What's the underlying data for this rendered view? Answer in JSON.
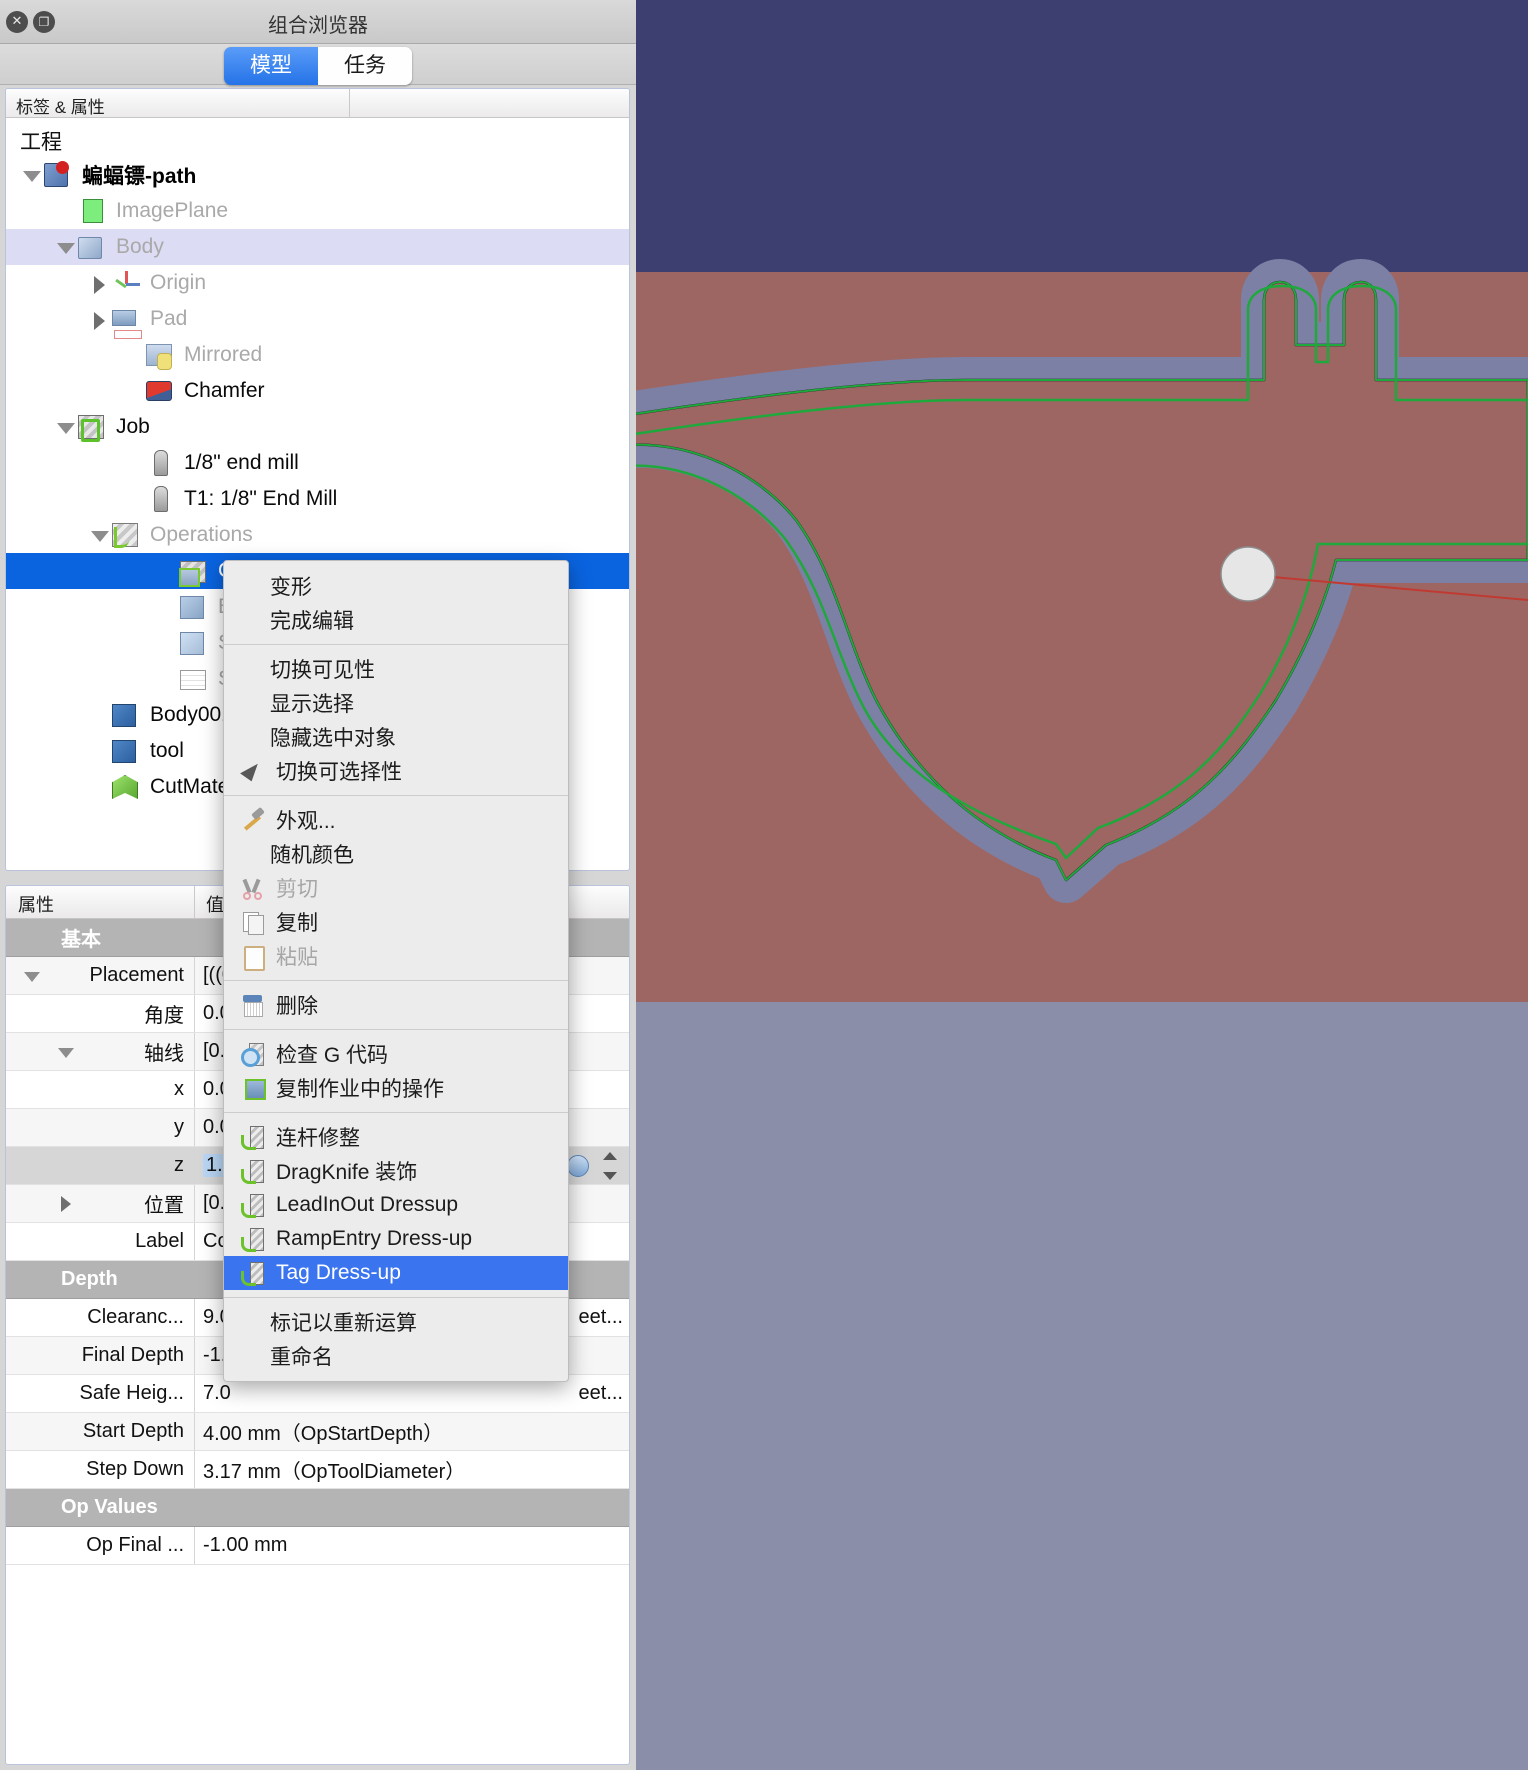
{
  "window": {
    "title": "组合浏览器",
    "close_label": "✕",
    "float_label": "❐"
  },
  "tabs": [
    {
      "label": "模型",
      "active": true
    },
    {
      "label": "任务",
      "active": false
    }
  ],
  "tree": {
    "header_col1": "标签 & 属性",
    "header_col2": "",
    "root_label": "工程",
    "items": [
      {
        "label": "蝙蝠镖-path",
        "indent": 0,
        "arrow": "down",
        "icon": "document-icon",
        "style": "bold"
      },
      {
        "label": "ImagePlane",
        "indent": 1,
        "arrow": "none",
        "icon": "image-plane-icon",
        "style": "muted"
      },
      {
        "label": "Body",
        "indent": 1,
        "arrow": "down",
        "icon": "body-icon",
        "style": "muted",
        "row": "lightsel"
      },
      {
        "label": "Origin",
        "indent": 2,
        "arrow": "right",
        "icon": "origin-icon",
        "style": "muted"
      },
      {
        "label": "Pad",
        "indent": 2,
        "arrow": "right",
        "icon": "pad-icon",
        "style": "muted"
      },
      {
        "label": "Mirrored",
        "indent": 3,
        "arrow": "none",
        "icon": "mirrored-icon",
        "style": "muted"
      },
      {
        "label": "Chamfer",
        "indent": 3,
        "arrow": "none",
        "icon": "chamfer-icon",
        "style": "dark"
      },
      {
        "label": "Job",
        "indent": 1,
        "arrow": "down",
        "icon": "job-icon",
        "style": "dark"
      },
      {
        "label": "1/8\" end mill",
        "indent": 3,
        "arrow": "none",
        "icon": "endmill-icon",
        "style": "dark"
      },
      {
        "label": "T1: 1/8\" End Mill",
        "indent": 3,
        "arrow": "none",
        "icon": "endmill-icon",
        "style": "dark"
      },
      {
        "label": "Operations",
        "indent": 2,
        "arrow": "down",
        "icon": "operations-icon",
        "style": "muted"
      },
      {
        "label": "Contour",
        "indent": 4,
        "arrow": "none",
        "icon": "contour-icon",
        "style": "selected",
        "row": "sel"
      },
      {
        "label": "Base-",
        "indent": 4,
        "arrow": "none",
        "icon": "cube-icon",
        "style": "muted"
      },
      {
        "label": "Stock",
        "indent": 4,
        "arrow": "none",
        "icon": "cube-pale-icon",
        "style": "muted"
      },
      {
        "label": "Setup",
        "indent": 4,
        "arrow": "none",
        "icon": "setup-icon",
        "style": "muted"
      },
      {
        "label": "Body001",
        "indent": 2,
        "arrow": "none",
        "icon": "cube-blue-icon",
        "style": "dark"
      },
      {
        "label": "tool",
        "indent": 2,
        "arrow": "none",
        "icon": "cube-blue-icon",
        "style": "dark"
      },
      {
        "label": "CutMaterial",
        "indent": 2,
        "arrow": "none",
        "icon": "cutmaterial-icon",
        "style": "dark"
      }
    ]
  },
  "context_menu": {
    "groups": [
      {
        "items": [
          {
            "label": "变形",
            "icon": "",
            "state": "normal"
          },
          {
            "label": "完成编辑",
            "icon": "",
            "state": "normal"
          }
        ]
      },
      {
        "items": [
          {
            "label": "切换可见性",
            "icon": "",
            "state": "normal"
          },
          {
            "label": "显示选择",
            "icon": "",
            "state": "normal"
          },
          {
            "label": "隐藏选中对象",
            "icon": "",
            "state": "normal"
          },
          {
            "label": "切换可选择性",
            "icon": "cursor-icon",
            "state": "normal"
          }
        ]
      },
      {
        "items": [
          {
            "label": "外观...",
            "icon": "hammer-icon",
            "state": "normal"
          },
          {
            "label": "随机颜色",
            "icon": "",
            "state": "normal"
          },
          {
            "label": "剪切",
            "icon": "scissors-icon",
            "state": "disabled"
          },
          {
            "label": "复制",
            "icon": "copy-icon",
            "state": "normal"
          },
          {
            "label": "粘贴",
            "icon": "paste-icon",
            "state": "disabled"
          }
        ]
      },
      {
        "items": [
          {
            "label": "删除",
            "icon": "trash-icon",
            "state": "normal"
          }
        ]
      },
      {
        "items": [
          {
            "label": "检查 G 代码",
            "icon": "gcode-icon",
            "state": "normal"
          },
          {
            "label": "复制作业中的操作",
            "icon": "duplicate-icon",
            "state": "normal"
          }
        ]
      },
      {
        "items": [
          {
            "label": "连杆修整",
            "icon": "dressup-icon",
            "state": "normal"
          },
          {
            "label": "DragKnife 装饰",
            "icon": "dressup-icon",
            "state": "normal"
          },
          {
            "label": "LeadInOut Dressup",
            "icon": "dressup-icon",
            "state": "normal"
          },
          {
            "label": "RampEntry Dress-up",
            "icon": "dressup-icon",
            "state": "normal"
          },
          {
            "label": "Tag Dress-up",
            "icon": "dressup-icon",
            "state": "highlighted"
          }
        ]
      },
      {
        "items": [
          {
            "label": "标记以重新运算",
            "icon": "",
            "state": "normal"
          },
          {
            "label": "重命名",
            "icon": "",
            "state": "normal"
          }
        ]
      }
    ]
  },
  "properties": {
    "header_name": "属性",
    "header_value": "值",
    "rows": [
      {
        "name": "基本",
        "value": "",
        "kind": "group"
      },
      {
        "name": "Placement",
        "value": "[((0",
        "kind": "alt",
        "twisty": "down",
        "indent": 0
      },
      {
        "name": "角度",
        "value": "0.0",
        "kind": "white",
        "twisty": "none",
        "indent": 1
      },
      {
        "name": "轴线",
        "value": "[0.",
        "kind": "alt",
        "twisty": "down",
        "indent": 1
      },
      {
        "name": "x",
        "value": "0.0",
        "kind": "white",
        "twisty": "none",
        "indent": 2
      },
      {
        "name": "y",
        "value": "0.0",
        "kind": "alt",
        "twisty": "none",
        "indent": 2
      },
      {
        "name": "z",
        "value": "1.0",
        "kind": "zrow",
        "twisty": "none",
        "indent": 2,
        "editing": true
      },
      {
        "name": "位置",
        "value": "[0.",
        "kind": "alt",
        "twisty": "right",
        "indent": 1
      },
      {
        "name": "Label",
        "value": "Co",
        "kind": "white",
        "twisty": "none",
        "indent": 0
      },
      {
        "name": "Depth",
        "value": "",
        "kind": "group"
      },
      {
        "name": "Clearanc...",
        "value": "9.0",
        "kind": "white",
        "twisty": "none",
        "indent": 0,
        "suffix": "eet..."
      },
      {
        "name": "Final Depth",
        "value": "-1.",
        "kind": "alt",
        "twisty": "none",
        "indent": 0
      },
      {
        "name": "Safe Heig...",
        "value": "7.0",
        "kind": "white",
        "twisty": "none",
        "indent": 0,
        "suffix": "eet..."
      },
      {
        "name": "Start Depth",
        "value": "4.00 mm（OpStartDepth）",
        "kind": "alt",
        "twisty": "none",
        "indent": 0
      },
      {
        "name": "Step Down",
        "value": "3.17 mm（OpToolDiameter）",
        "kind": "white",
        "twisty": "none",
        "indent": 0
      },
      {
        "name": "Op  Values",
        "value": "",
        "kind": "group"
      },
      {
        "name": "Op Final ...",
        "value": "-1.00 mm",
        "kind": "white",
        "twisty": "none",
        "indent": 0
      }
    ]
  },
  "viewport": {
    "colors": {
      "sky": "#3d3f70",
      "stock": "#9d6663",
      "floor": "#8b8ea8",
      "path_band": "#7d80a5",
      "path_line": "#1fa83c",
      "outline": "#20202a",
      "circle": "#e4e4e4",
      "red_line": "#c03a32"
    }
  }
}
